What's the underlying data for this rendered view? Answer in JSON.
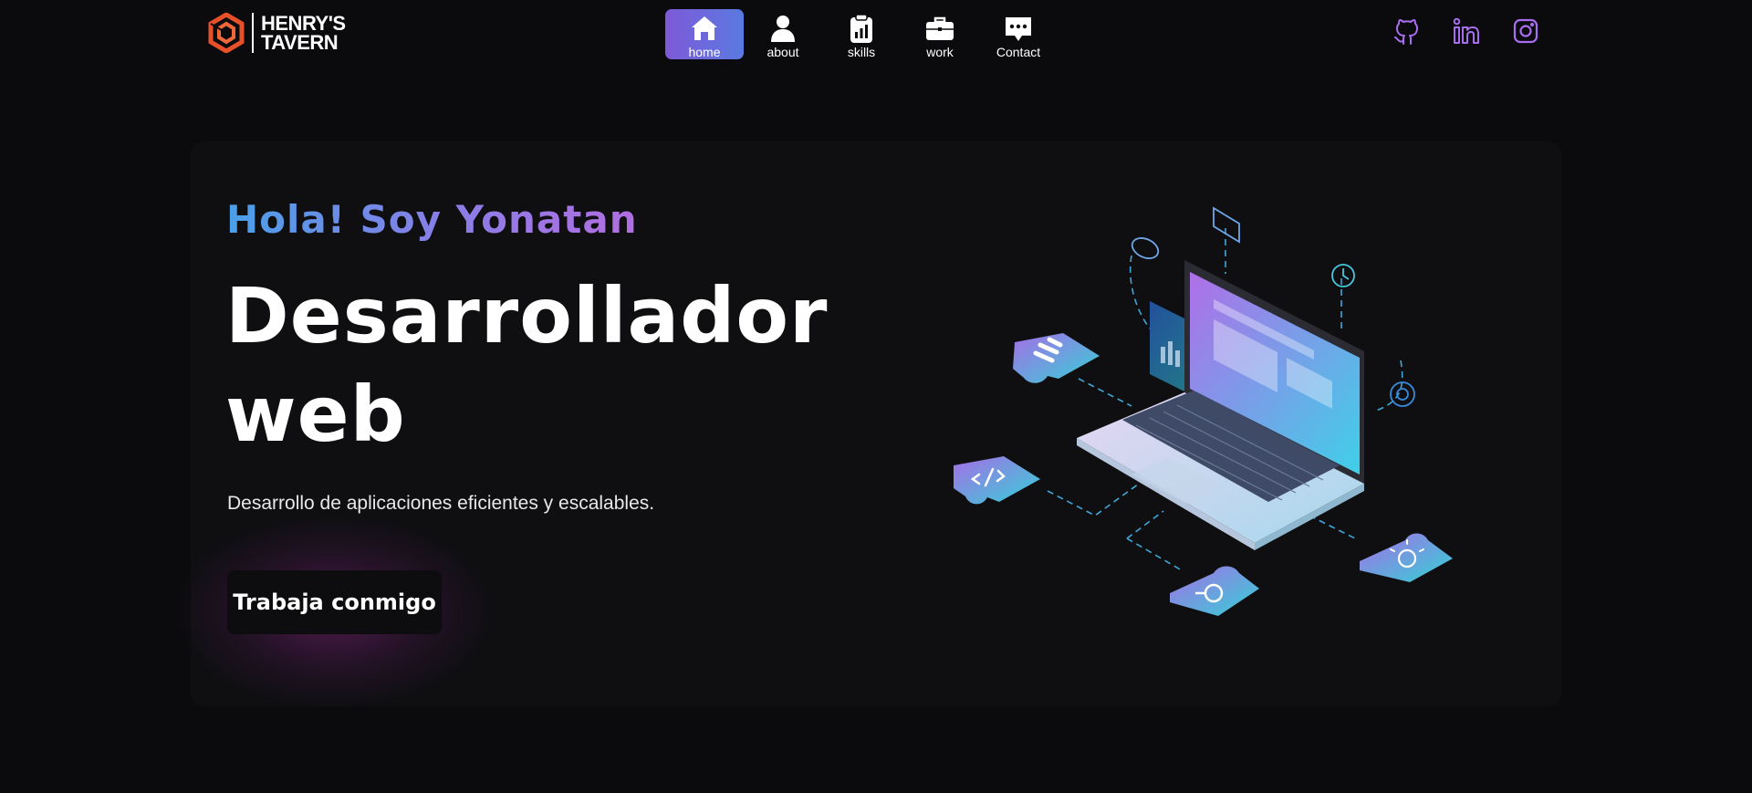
{
  "brand": {
    "logo_line1": "HENRY'S",
    "logo_line2": "TAVERN",
    "accent": "#e8502a"
  },
  "nav": {
    "items": [
      {
        "label": "home",
        "icon": "home-icon",
        "active": true
      },
      {
        "label": "about",
        "icon": "user-icon",
        "active": false
      },
      {
        "label": "skills",
        "icon": "clipboard-chart-icon",
        "active": false
      },
      {
        "label": "work",
        "icon": "briefcase-icon",
        "active": false
      },
      {
        "label": "Contact",
        "icon": "chat-icon",
        "active": false
      }
    ],
    "active_color": "#6a6ade"
  },
  "socials": {
    "items": [
      {
        "icon": "github-icon"
      },
      {
        "icon": "linkedin-icon"
      },
      {
        "icon": "instagram-icon"
      }
    ],
    "color": "#a86ef0"
  },
  "hero": {
    "greeting": "Hola! Soy Yonatan",
    "title_line1": "Desarrollador",
    "title_line2": "web",
    "subtitle": "Desarrollo de aplicaciones eficientes y escalables.",
    "cta_label": "Trabaja conmigo",
    "illustration_icon": "laptop-puzzle-illustration-icon"
  }
}
